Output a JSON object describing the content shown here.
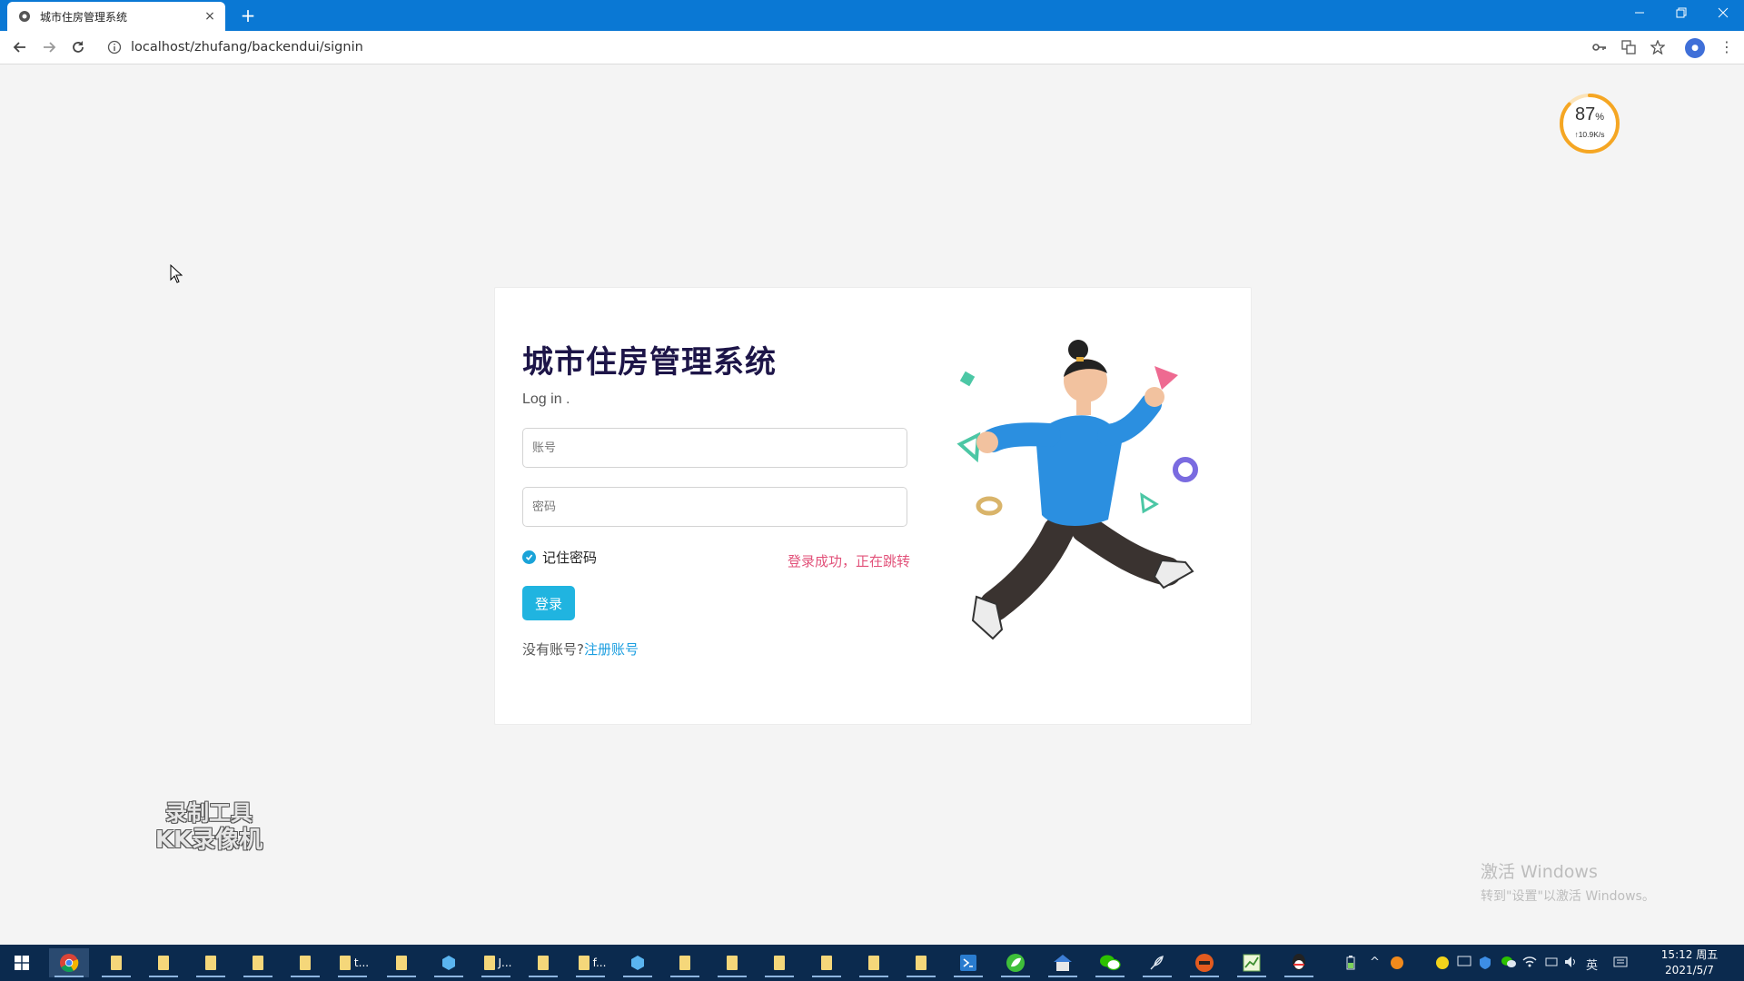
{
  "browser": {
    "tab_title": "城市住房管理系统",
    "tab_close": "×",
    "new_tab": "+",
    "url": "localhost/zhufang/backendui/signin"
  },
  "net_meter": {
    "percent": "87",
    "percent_unit": "%",
    "speed": "↑10.9K/s",
    "level": 0.87
  },
  "login": {
    "title": "城市住房管理系统",
    "subtitle": "Log in .",
    "username_placeholder": "账号",
    "password_placeholder": "密码",
    "remember_label": "记住密码",
    "remember_checked": true,
    "status_message": "登录成功，正在跳转",
    "submit_label": "登录",
    "no_account_text": "没有账号?",
    "register_link": "注册账号"
  },
  "overlays": {
    "recorder_line1": "录制工具",
    "recorder_line2": "KK录像机",
    "activate_title": "激活 Windows",
    "activate_hint": "转到\"设置\"以激活 Windows。"
  },
  "taskbar": {
    "item_t": "t...",
    "item_j": "J...",
    "item_f": "f...",
    "ime": "英",
    "time": "15:12 周五",
    "date": "2021/5/7"
  },
  "colors": {
    "chrome_blue": "#0a78d4",
    "title_navy": "#1d1548",
    "button_cyan": "#20b4e0",
    "status_pink": "#e2527a",
    "link_blue": "#1b9ee0",
    "meter_orange": "#f5a623"
  },
  "icons": [
    "chrome-icon",
    "back-arrow-icon",
    "forward-arrow-icon",
    "reload-icon",
    "info-icon",
    "key-icon",
    "translate-icon",
    "star-icon",
    "windows-start-icon",
    "wechat-icon",
    "folder-icon"
  ]
}
